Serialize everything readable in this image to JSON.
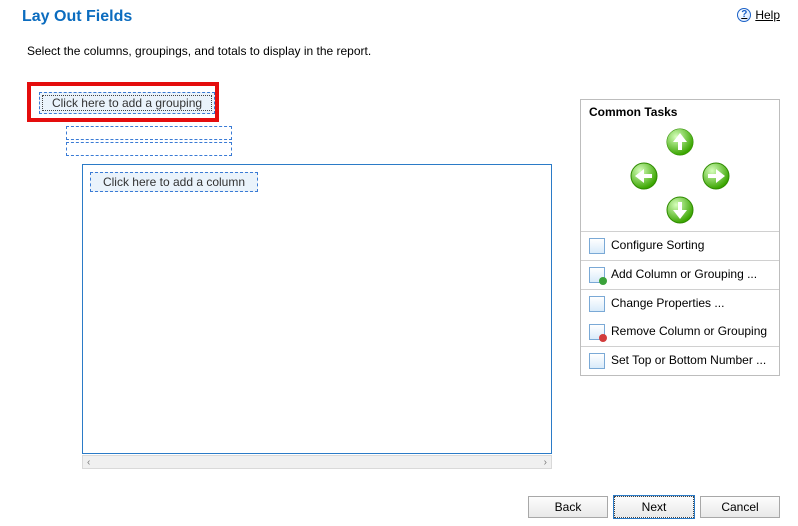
{
  "header": {
    "title": "Lay Out Fields",
    "help_label": "Help"
  },
  "instruction": "Select the columns, groupings, and totals to display in the report.",
  "canvas": {
    "add_grouping_label": "Click here to add a grouping",
    "add_column_label": "Click here to add a column"
  },
  "tasks": {
    "title": "Common Tasks",
    "items": {
      "configure_sorting": "Configure Sorting",
      "add_column_or_grouping": "Add Column or Grouping ...",
      "change_properties": "Change Properties ...",
      "remove_column_or_grouping": "Remove Column or Grouping",
      "set_top_or_bottom_number": "Set Top or Bottom Number ..."
    }
  },
  "buttons": {
    "back": "Back",
    "next": "Next",
    "cancel": "Cancel"
  }
}
